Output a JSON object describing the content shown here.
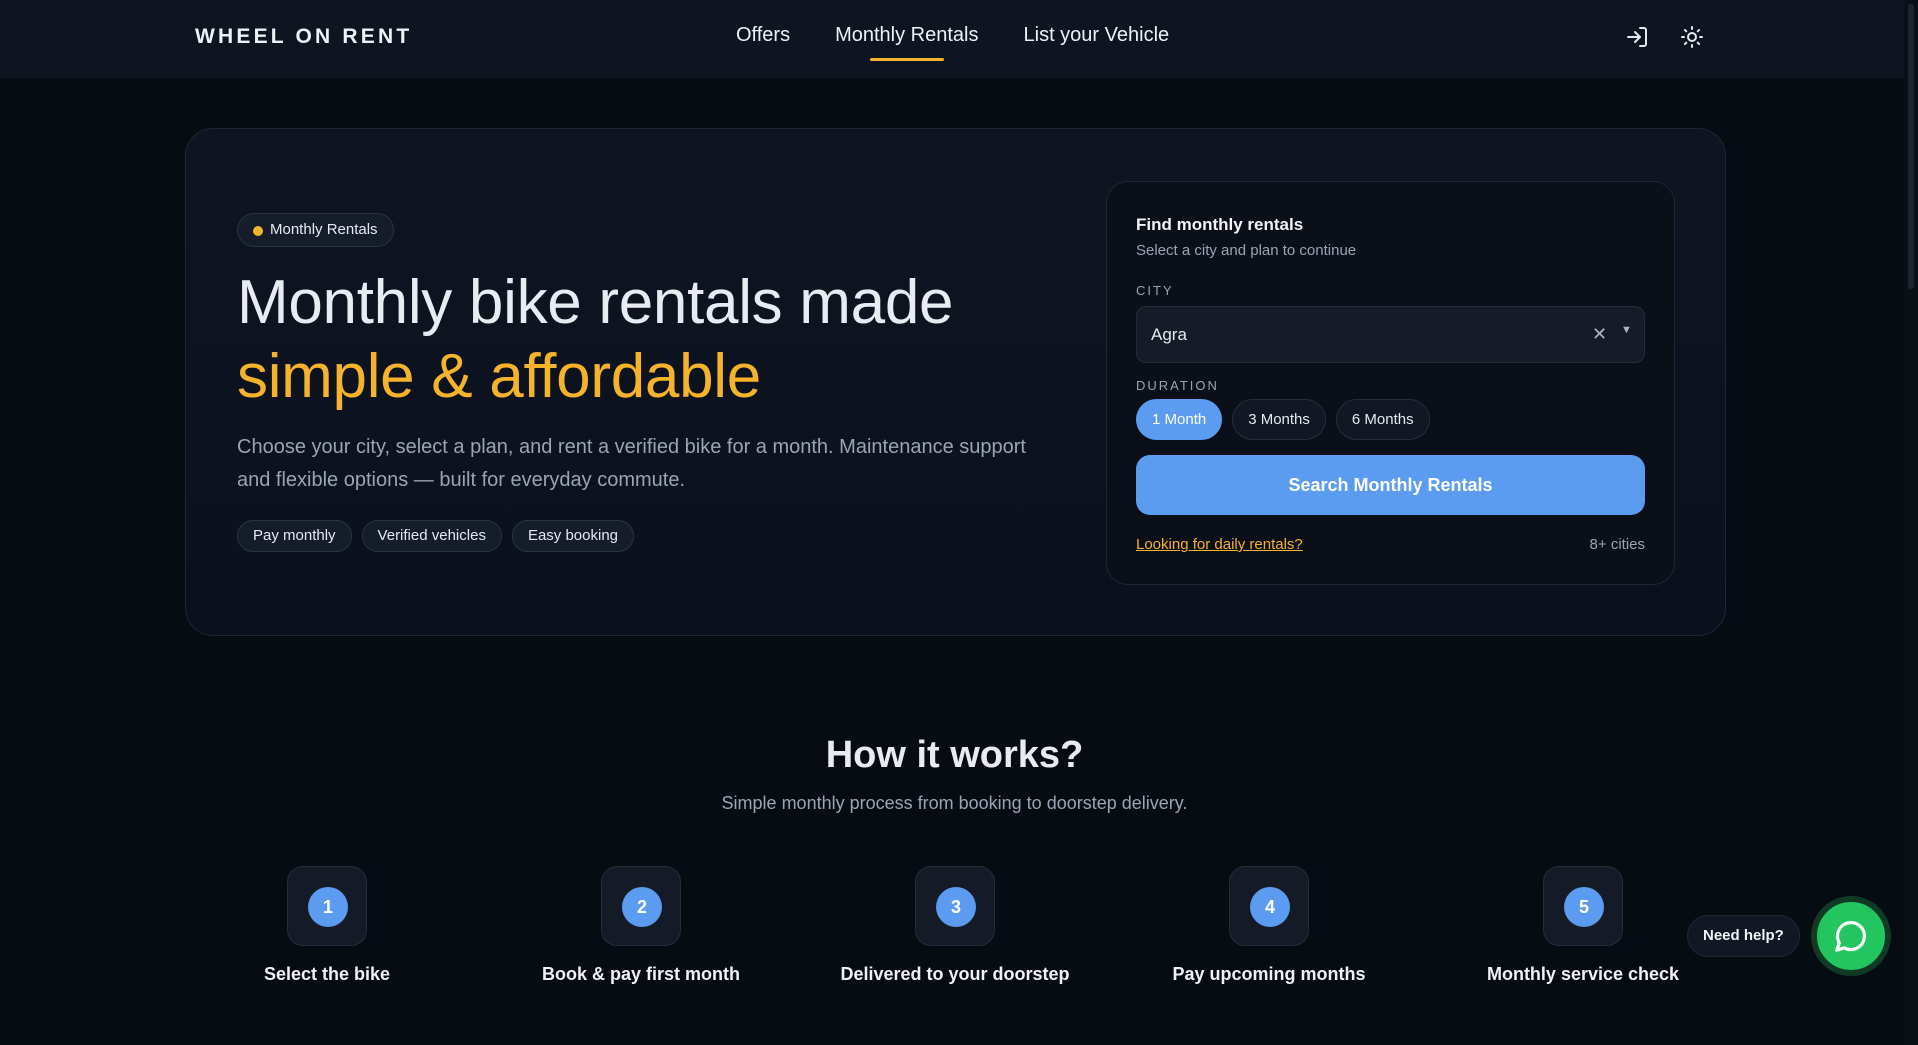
{
  "header": {
    "brand": "WHEEL ON RENT",
    "nav": [
      {
        "label": "Offers",
        "active": false
      },
      {
        "label": "Monthly Rentals",
        "active": true
      },
      {
        "label": "List your Vehicle",
        "active": false
      }
    ],
    "icons": [
      "login-icon",
      "sun-icon"
    ]
  },
  "hero": {
    "pill": "Monthly Rentals",
    "title_line1": "Monthly bike rentals made",
    "title_line2": "simple & affordable",
    "description": "Choose your city, select a plan, and rent a verified bike for a month. Maintenance support and flexible options — built for everyday commute.",
    "tags": [
      "Pay monthly",
      "Verified vehicles",
      "Easy booking"
    ]
  },
  "search_card": {
    "title": "Find monthly rentals",
    "subtitle": "Select a city and plan to continue",
    "city_label": "CITY",
    "city_value": "Agra",
    "duration_label": "DURATION",
    "durations": [
      {
        "label": "1 Month",
        "selected": true
      },
      {
        "label": "3 Months",
        "selected": false
      },
      {
        "label": "6 Months",
        "selected": false
      }
    ],
    "search_button": "Search Monthly Rentals",
    "daily_link": "Looking for daily rentals?",
    "cities_count": "8+ cities"
  },
  "how_it_works": {
    "title": "How it works?",
    "subtitle": "Simple monthly process from booking to doorstep delivery.",
    "steps": [
      {
        "num": "1",
        "label": "Select the bike"
      },
      {
        "num": "2",
        "label": "Book & pay first month"
      },
      {
        "num": "3",
        "label": "Delivered to your doorstep"
      },
      {
        "num": "4",
        "label": "Pay upcoming months"
      },
      {
        "num": "5",
        "label": "Monthly service check"
      }
    ]
  },
  "help": {
    "label": "Need help?",
    "icon": "chat-bubble-icon"
  },
  "colors": {
    "accent_yellow": "#f4b32a",
    "accent_blue": "#5b9cf1",
    "help_green": "#22c55e",
    "background": "#070b12"
  }
}
